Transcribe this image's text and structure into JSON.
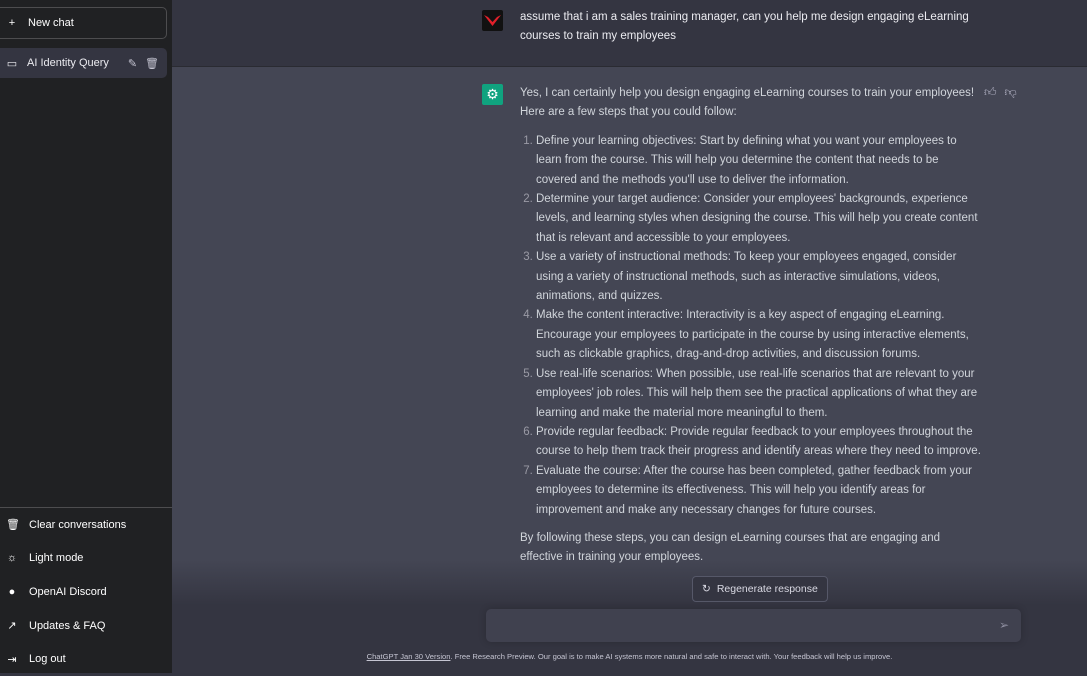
{
  "sidebar": {
    "new_chat": "New chat",
    "conversations": [
      {
        "title": "AI Identity Query"
      }
    ],
    "bottom": [
      {
        "label": "Clear conversations",
        "icon": "trash-icon"
      },
      {
        "label": "Light mode",
        "icon": "sun-icon"
      },
      {
        "label": "OpenAI Discord",
        "icon": "discord-icon"
      },
      {
        "label": "Updates & FAQ",
        "icon": "external-link-icon"
      },
      {
        "label": "Log out",
        "icon": "logout-icon"
      }
    ]
  },
  "user_message": "assume that i am a sales training manager, can you help me design engaging eLearning courses to train my employees",
  "assistant": {
    "intro": "Yes, I can certainly help you design engaging eLearning courses to train your employees! Here are a few steps that you could follow:",
    "steps": [
      "Define your learning objectives: Start by defining what you want your employees to learn from the course. This will help you determine the content that needs to be covered and the methods you'll use to deliver the information.",
      "Determine your target audience: Consider your employees' backgrounds, experience levels, and learning styles when designing the course. This will help you create content that is relevant and accessible to your employees.",
      "Use a variety of instructional methods: To keep your employees engaged, consider using a variety of instructional methods, such as interactive simulations, videos, animations, and quizzes.",
      "Make the content interactive: Interactivity is a key aspect of engaging eLearning. Encourage your employees to participate in the course by using interactive elements, such as clickable graphics, drag-and-drop activities, and discussion forums.",
      "Use real-life scenarios: When possible, use real-life scenarios that are relevant to your employees' job roles. This will help them see the practical applications of what they are learning and make the material more meaningful to them.",
      "Provide regular feedback: Provide regular feedback to your employees throughout the course to help them track their progress and identify areas where they need to improve.",
      "Evaluate the course: After the course has been completed, gather feedback from your employees to determine its effectiveness. This will help you identify areas for improvement and make any necessary changes for future courses."
    ],
    "outro": "By following these steps, you can design eLearning courses that are engaging and effective in training your employees."
  },
  "regenerate": "Regenerate response",
  "input": {
    "value": "",
    "placeholder": ""
  },
  "footer": {
    "link": "ChatGPT Jan 30 Version",
    "text": ". Free Research Preview. Our goal is to make AI systems more natural and safe to interact with. Your feedback will help us improve."
  },
  "colors": {
    "sidebar": "#202123",
    "main": "#343541",
    "assistant_row": "#444654",
    "assistant_avatar": "#10a37f"
  }
}
